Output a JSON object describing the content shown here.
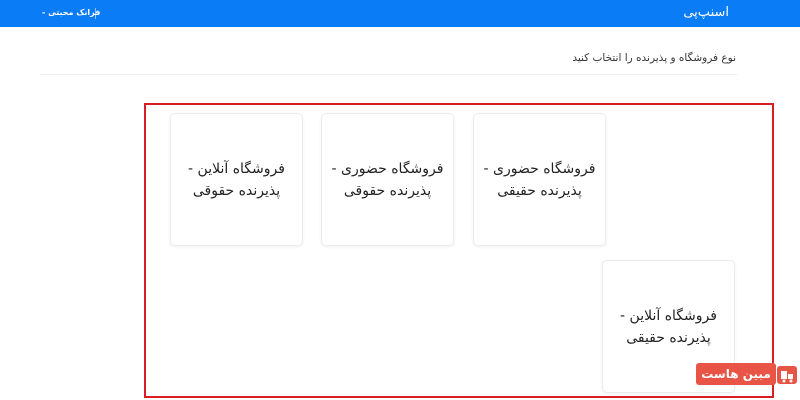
{
  "header": {
    "brand": "اسنپ‌پی",
    "user_menu": "فرانک محبتی -"
  },
  "instruction": "نوع فروشگاه و پذیرنده را انتخاب کنید",
  "options": [
    {
      "line1": "فروشگاه حضوری -",
      "line2": "پذیرنده حقیقی"
    },
    {
      "line1": "فروشگاه حضوری -",
      "line2": "پذیرنده حقوقی"
    },
    {
      "line1": "فروشگاه آنلاین -",
      "line2": "پذیرنده حقوقی"
    },
    {
      "line1": "فروشگاه آنلاین -",
      "line2": "پذیرنده حقیقی"
    }
  ],
  "watermark": {
    "text": "مبین هاست",
    "icon": "host-logo-icon"
  },
  "colors": {
    "header_bg": "#0a7cf5",
    "highlight_border": "#d81e24",
    "watermark_bg": "#e85445"
  }
}
